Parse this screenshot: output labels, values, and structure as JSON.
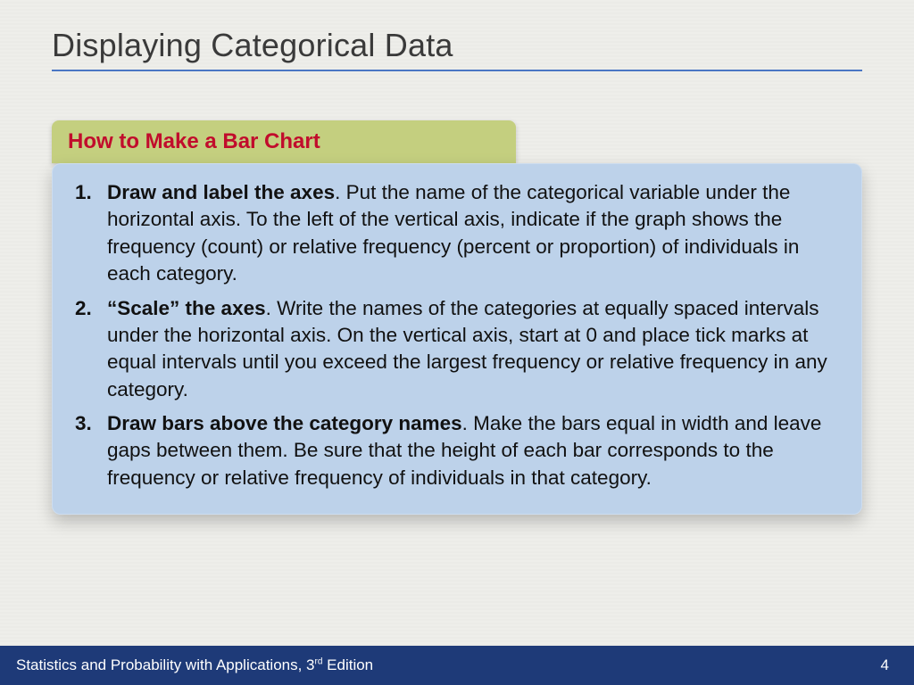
{
  "title": "Displaying Categorical Data",
  "callout": {
    "header": "How to Make a Bar Chart"
  },
  "steps": [
    {
      "lead": "Draw and label the axes",
      "body": ". Put the name of the categorical variable under the horizontal axis. To the left of the vertical axis, indicate if the graph shows the frequency (count) or relative frequency (percent or proportion) of individuals in each category."
    },
    {
      "lead": "“Scale” the axes",
      "body": ". Write the names of the categories at equally spaced intervals under the horizontal axis. On the vertical axis, start at 0 and place tick marks at equal intervals until you exceed the largest frequency or relative frequency in any category."
    },
    {
      "lead": "Draw bars above the category names",
      "body": ". Make the bars equal in width and leave gaps between them. Be sure that the height of each bar corresponds to the frequency or relative frequency of individuals in that category."
    }
  ],
  "footer": {
    "book_prefix": "Statistics and Probability with Applications, 3",
    "book_ord": "rd",
    "book_suffix": " Edition",
    "page": "4"
  }
}
